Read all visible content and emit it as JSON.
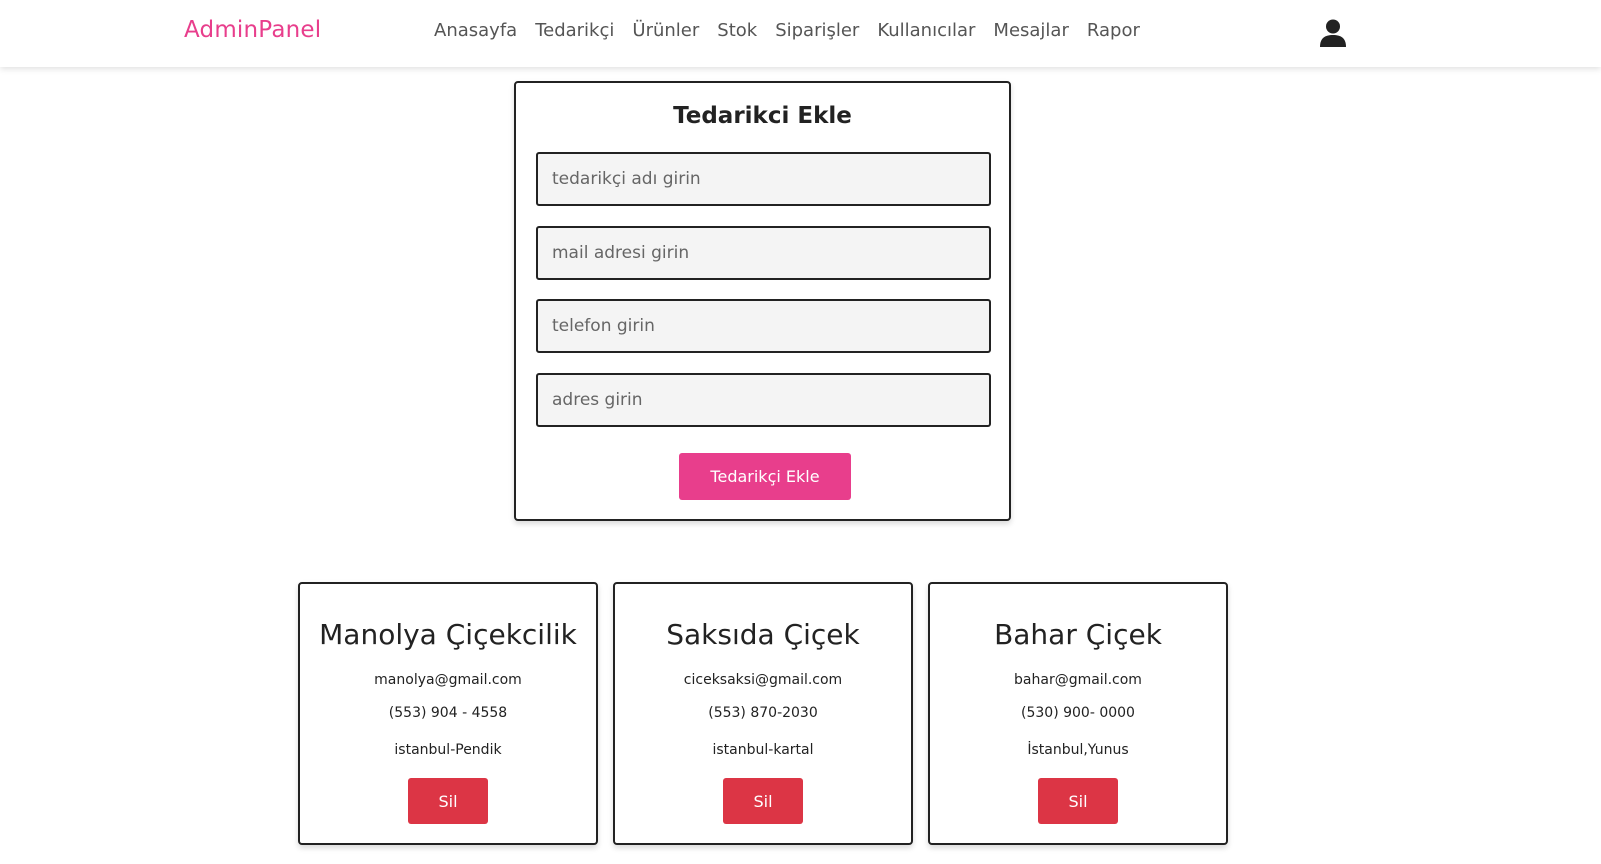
{
  "navbar": {
    "brand": "AdminPanel",
    "links": [
      "Anasayfa",
      "Tedarikçi",
      "Ürünler",
      "Stok",
      "Siparişler",
      "Kullanıcılar",
      "Mesajlar",
      "Rapor"
    ],
    "user_icon": "user-icon"
  },
  "form": {
    "title": "Tedarikci Ekle",
    "name_placeholder": "tedarikçi adı girin",
    "mail_placeholder": "mail adresi girin",
    "phone_placeholder": "telefon girin",
    "address_placeholder": "adres girin",
    "submit_label": "Tedarikçi Ekle"
  },
  "suppliers": [
    {
      "name": "Manolya Çiçekcilik",
      "email": "manolya@gmail.com",
      "phone": "(553) 904 - 4558",
      "address": "istanbul-Pendik",
      "delete_label": "Sil"
    },
    {
      "name": "Saksıda Çiçek",
      "email": "ciceksaksi@gmail.com",
      "phone": "(553) 870-2030",
      "address": "istanbul-kartal",
      "delete_label": "Sil"
    },
    {
      "name": "Bahar Çiçek",
      "email": "bahar@gmail.com",
      "phone": "(530) 900- 0000",
      "address": "İstanbul,Yunus",
      "delete_label": "Sil"
    }
  ],
  "colors": {
    "brand": "#e83e8c",
    "primary_button": "#e83e8c",
    "danger_button": "#dc3545"
  }
}
